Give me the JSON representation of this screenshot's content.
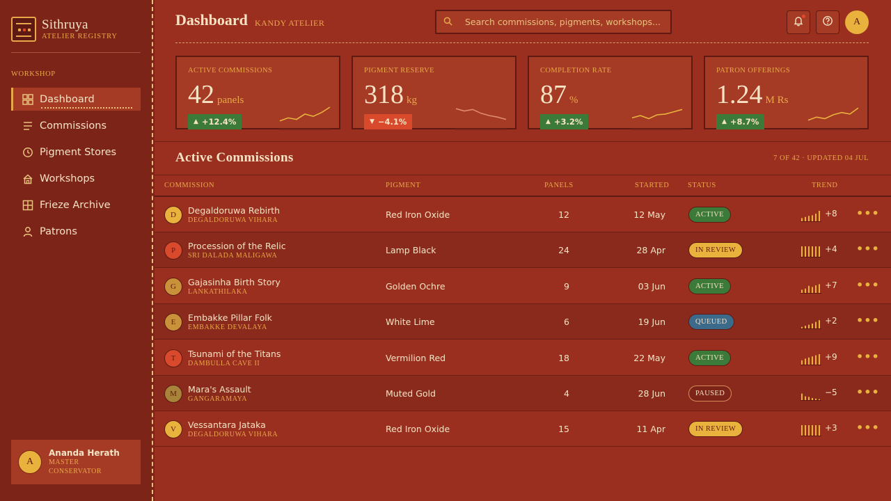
{
  "colors": {
    "accent": "#e9b23c",
    "background": "#9a2f1f",
    "sidebar": "#7d2419",
    "positive": "#3c7a3a",
    "negative": "#d94a2d"
  },
  "brand": {
    "name": "Sithruya",
    "subtitle": "ATELIER REGISTRY"
  },
  "sidebar": {
    "section_label": "WORKSHOP",
    "items": [
      {
        "label": "Dashboard",
        "icon": "grid-icon",
        "active": true
      },
      {
        "label": "Commissions",
        "icon": "list-icon"
      },
      {
        "label": "Pigment Stores",
        "icon": "clock-icon"
      },
      {
        "label": "Workshops",
        "icon": "home-icon"
      },
      {
        "label": "Frieze Archive",
        "icon": "grid-icon"
      },
      {
        "label": "Patrons",
        "icon": "user-icon"
      }
    ],
    "user": {
      "initial": "A",
      "name": "Ananda Herath",
      "role": "MASTER CONSERVATOR"
    }
  },
  "header": {
    "title": "Dashboard",
    "subtitle": "KANDY ATELIER",
    "search_placeholder": "Search commissions, pigments, workshops...",
    "avatar_initial": "A"
  },
  "stats": [
    {
      "label": "ACTIVE COMMISSIONS",
      "value": "42",
      "unit": "panels",
      "delta": "+12.4%",
      "direction": "up",
      "trend": [
        0.1,
        0.3,
        0.2,
        0.55,
        0.4,
        0.65,
        1.0
      ]
    },
    {
      "label": "PIGMENT RESERVE",
      "value": "318",
      "unit": "kg",
      "delta": "−4.1%",
      "direction": "down",
      "trend": [
        0.9,
        0.75,
        0.85,
        0.6,
        0.45,
        0.35,
        0.2
      ]
    },
    {
      "label": "COMPLETION RATE",
      "value": "87",
      "unit": "%",
      "delta": "+3.2%",
      "direction": "up",
      "trend": [
        0.3,
        0.45,
        0.25,
        0.5,
        0.55,
        0.7,
        0.85
      ]
    },
    {
      "label": "PATRON OFFERINGS",
      "value": "1.24",
      "unit": "M Rs",
      "delta": "+8.7%",
      "direction": "up",
      "trend": [
        0.15,
        0.35,
        0.25,
        0.5,
        0.65,
        0.55,
        0.95
      ]
    }
  ],
  "commissions": {
    "title": "Active Commissions",
    "meta": "7 OF 42 · UPDATED 04 JUL",
    "columns": [
      "COMMISSION",
      "PIGMENT",
      "PANELS",
      "STARTED",
      "STATUS",
      "TREND"
    ],
    "rows": [
      {
        "initial": "D",
        "name": "Degaldoruwa Rebirth",
        "site": "DEGALDORUWA VIHARA",
        "pigment": "Red Iron Oxide",
        "panels": "12",
        "started": "12 May",
        "status": "ACTIVE",
        "status_type": "active",
        "trend": "+8",
        "avatar_color": "#e9b23c",
        "bars": [
          0.35,
          0.45,
          0.55,
          0.6,
          0.75,
          1.0
        ]
      },
      {
        "initial": "P",
        "name": "Procession of the Relic",
        "site": "SRI DALADA MALIGAWA",
        "pigment": "Lamp Black",
        "panels": "24",
        "started": "28 Apr",
        "status": "IN REVIEW",
        "status_type": "review",
        "trend": "+4",
        "avatar_color": "#d94a2d",
        "bars": [
          1.0,
          1.0,
          1.0,
          1.0,
          1.0,
          1.0
        ]
      },
      {
        "initial": "G",
        "name": "Gajasinha Birth Story",
        "site": "LANKATHILAKA",
        "pigment": "Golden Ochre",
        "panels": "9",
        "started": "03 Jun",
        "status": "ACTIVE",
        "status_type": "active",
        "trend": "+7",
        "avatar_color": "#c9923a",
        "bars": [
          0.35,
          0.45,
          0.7,
          0.6,
          0.75,
          0.85
        ]
      },
      {
        "initial": "E",
        "name": "Embakke Pillar Folk",
        "site": "EMBAKKE DEVALAYA",
        "pigment": "White Lime",
        "panels": "6",
        "started": "19 Jun",
        "status": "QUEUED",
        "status_type": "queued",
        "trend": "+2",
        "avatar_color": "#c9923a",
        "bars": [
          0.2,
          0.3,
          0.4,
          0.5,
          0.65,
          0.8
        ]
      },
      {
        "initial": "T",
        "name": "Tsunami of the Titans",
        "site": "DAMBULLA CAVE II",
        "pigment": "Vermilion Red",
        "panels": "18",
        "started": "22 May",
        "status": "ACTIVE",
        "status_type": "active",
        "trend": "+9",
        "avatar_color": "#d94a2d",
        "bars": [
          0.45,
          0.6,
          0.7,
          0.8,
          0.9,
          1.0
        ]
      },
      {
        "initial": "M",
        "name": "Mara's Assault",
        "site": "GANGARAMAYA",
        "pigment": "Muted Gold",
        "panels": "4",
        "started": "28 Jun",
        "status": "PAUSED",
        "status_type": "paused",
        "trend": "−5",
        "avatar_color": "#a8833a",
        "bars": [
          0.65,
          0.4,
          0.35,
          0.25,
          0.2,
          0.15
        ]
      },
      {
        "initial": "V",
        "name": "Vessantara Jataka",
        "site": "DEGALDORUWA VIHARA",
        "pigment": "Red Iron Oxide",
        "panels": "15",
        "started": "11 Apr",
        "status": "IN REVIEW",
        "status_type": "review",
        "trend": "+3",
        "avatar_color": "#e9b23c",
        "bars": [
          1.0,
          1.0,
          1.0,
          1.0,
          1.0,
          1.0
        ]
      }
    ]
  }
}
